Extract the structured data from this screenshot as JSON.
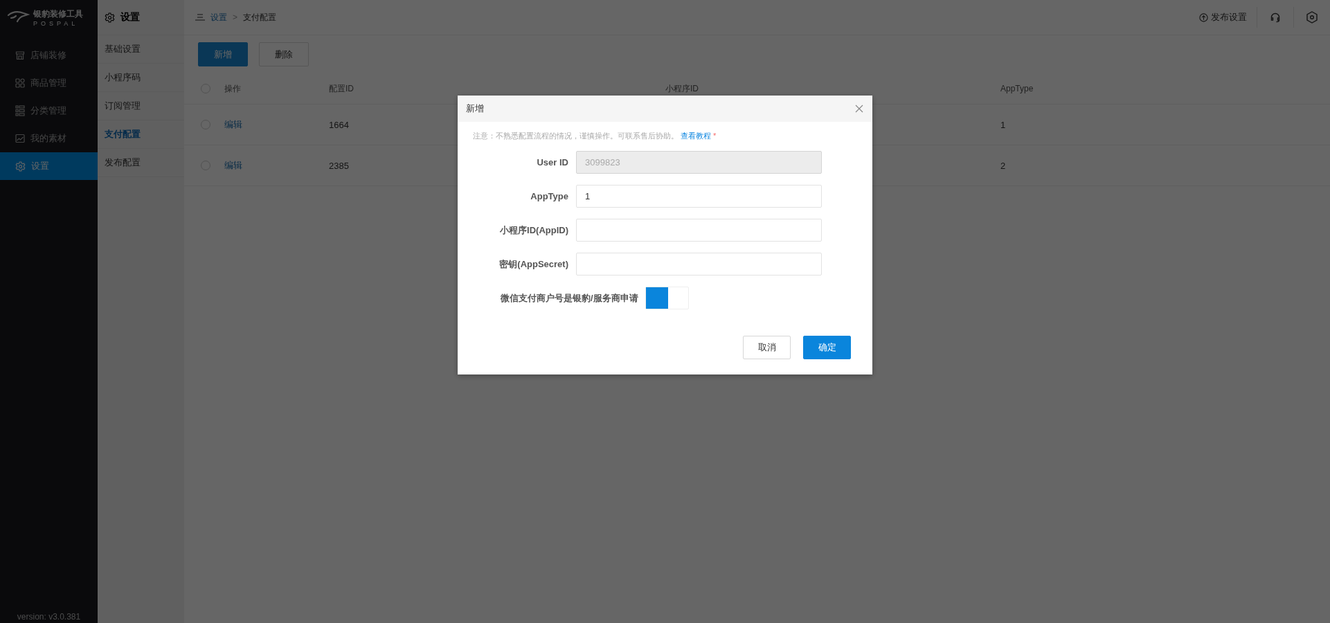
{
  "sidebar": {
    "logo": {
      "title": "银豹装修工具",
      "subtitle": "POSPAL"
    },
    "items": [
      {
        "label": "店铺装修",
        "selected": false
      },
      {
        "label": "商品管理",
        "selected": false
      },
      {
        "label": "分类管理",
        "selected": false
      },
      {
        "label": "我的素材",
        "selected": false
      },
      {
        "label": "设置",
        "selected": true
      }
    ],
    "version": "version: v3.0.381"
  },
  "subnav": {
    "title": "设置",
    "items": [
      {
        "label": "基础设置",
        "selected": false
      },
      {
        "label": "小程序码",
        "selected": false
      },
      {
        "label": "订阅管理",
        "selected": false
      },
      {
        "label": "支付配置",
        "selected": true
      },
      {
        "label": "发布配置",
        "selected": false
      }
    ]
  },
  "header": {
    "breadcrumb": {
      "parent": "设置",
      "separator": ">",
      "current": "支付配置"
    },
    "publish_label": "发布设置"
  },
  "toolbar": {
    "buttons": [
      {
        "label": "新增",
        "kind": "primary"
      },
      {
        "label": "删除",
        "kind": "default"
      }
    ]
  },
  "table": {
    "all_checked": false,
    "columns": [
      "操作",
      "配置ID",
      "小程序ID",
      "AppType"
    ],
    "rows": [
      {
        "checked": false,
        "action": "编辑",
        "config_id": "1664",
        "app_type": "1"
      },
      {
        "checked": false,
        "action": "编辑",
        "config_id": "2385",
        "app_type": "2"
      }
    ]
  },
  "modal": {
    "title": "新增",
    "note": "注意：不熟悉配置流程的情况，谨慎操作。可联系售后协助。",
    "note_link": "查看教程",
    "required_mark": "*",
    "fields": [
      {
        "kind": "input",
        "label": "User ID",
        "value": "3099823",
        "disabled": true
      },
      {
        "kind": "input",
        "label": "AppType",
        "value": "1",
        "disabled": false
      },
      {
        "kind": "input",
        "label": "小程序ID(AppID)",
        "disabled": false
      },
      {
        "kind": "input",
        "label": "密钥(AppSecret)",
        "disabled": false
      },
      {
        "kind": "switch",
        "label": "微信支付商户号是银豹/服务商申请",
        "on": true
      }
    ],
    "buttons": [
      {
        "label": "取消",
        "kind": "default"
      },
      {
        "label": "确定",
        "kind": "primary"
      }
    ]
  }
}
